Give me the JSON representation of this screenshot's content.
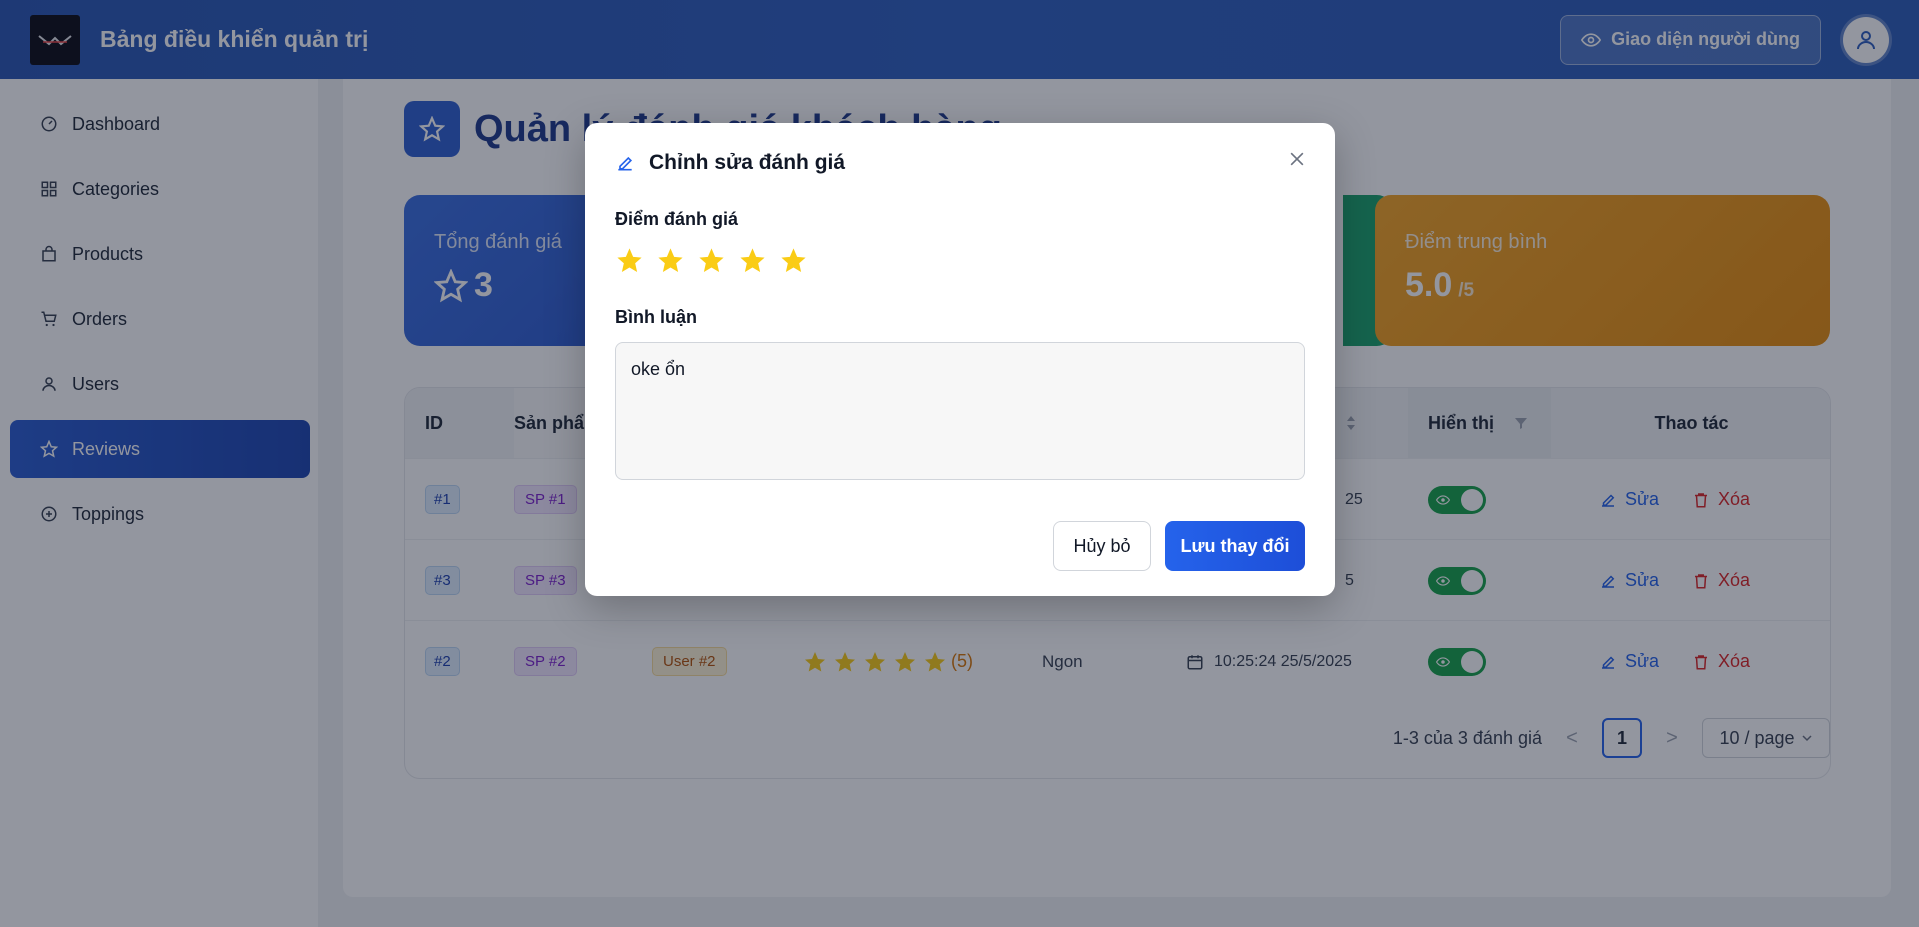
{
  "header": {
    "title": "Bảng điều khiển quản trị",
    "user_view_label": "Giao diện người dùng"
  },
  "sidebar": {
    "items": [
      {
        "label": "Dashboard",
        "icon": "dashboard-icon"
      },
      {
        "label": "Categories",
        "icon": "grid-icon"
      },
      {
        "label": "Products",
        "icon": "bag-icon"
      },
      {
        "label": "Orders",
        "icon": "cart-icon"
      },
      {
        "label": "Users",
        "icon": "user-icon"
      },
      {
        "label": "Reviews",
        "icon": "star-icon",
        "active": true
      },
      {
        "label": "Toppings",
        "icon": "plus-circle-icon"
      }
    ]
  },
  "page": {
    "title": "Quản lý đánh giá khách hàng"
  },
  "stats": {
    "total_label": "Tổng đánh giá",
    "total_value": "3",
    "avg_label": "Điểm trung bình",
    "avg_value": "5.0",
    "avg_unit": "/5"
  },
  "table": {
    "headers": {
      "id": "ID",
      "product": "Sản phẩm",
      "show": "Hiển thị",
      "actions": "Thao tác"
    },
    "edit_label": "Sửa",
    "delete_label": "Xóa",
    "rows": [
      {
        "id": "#1",
        "product": "SP #1",
        "date": "25"
      },
      {
        "id": "#3",
        "product": "SP #3",
        "date": "5"
      },
      {
        "id": "#2",
        "product": "SP #2",
        "user": "User #2",
        "rating": 5,
        "count": "(5)",
        "comment": "Ngon",
        "date": "10:25:24 25/5/2025"
      }
    ],
    "pagination": {
      "summary": "1-3 của 3 đánh giá",
      "prev": "<",
      "page": "1",
      "next": ">",
      "page_size": "10 / page"
    }
  },
  "modal": {
    "title": "Chỉnh sửa đánh giá",
    "rating_label": "Điểm đánh giá",
    "rating_value": 5,
    "comment_label": "Bình luận",
    "comment_value": "oke ổn",
    "cancel_label": "Hủy bỏ",
    "save_label": "Lưu thay đổi"
  },
  "colors": {
    "header": "#2f5fbf",
    "accent": "#2563eb",
    "star": "#facc15",
    "success": "#16a34a",
    "danger": "#dc2626",
    "warning": "#f5a524"
  }
}
